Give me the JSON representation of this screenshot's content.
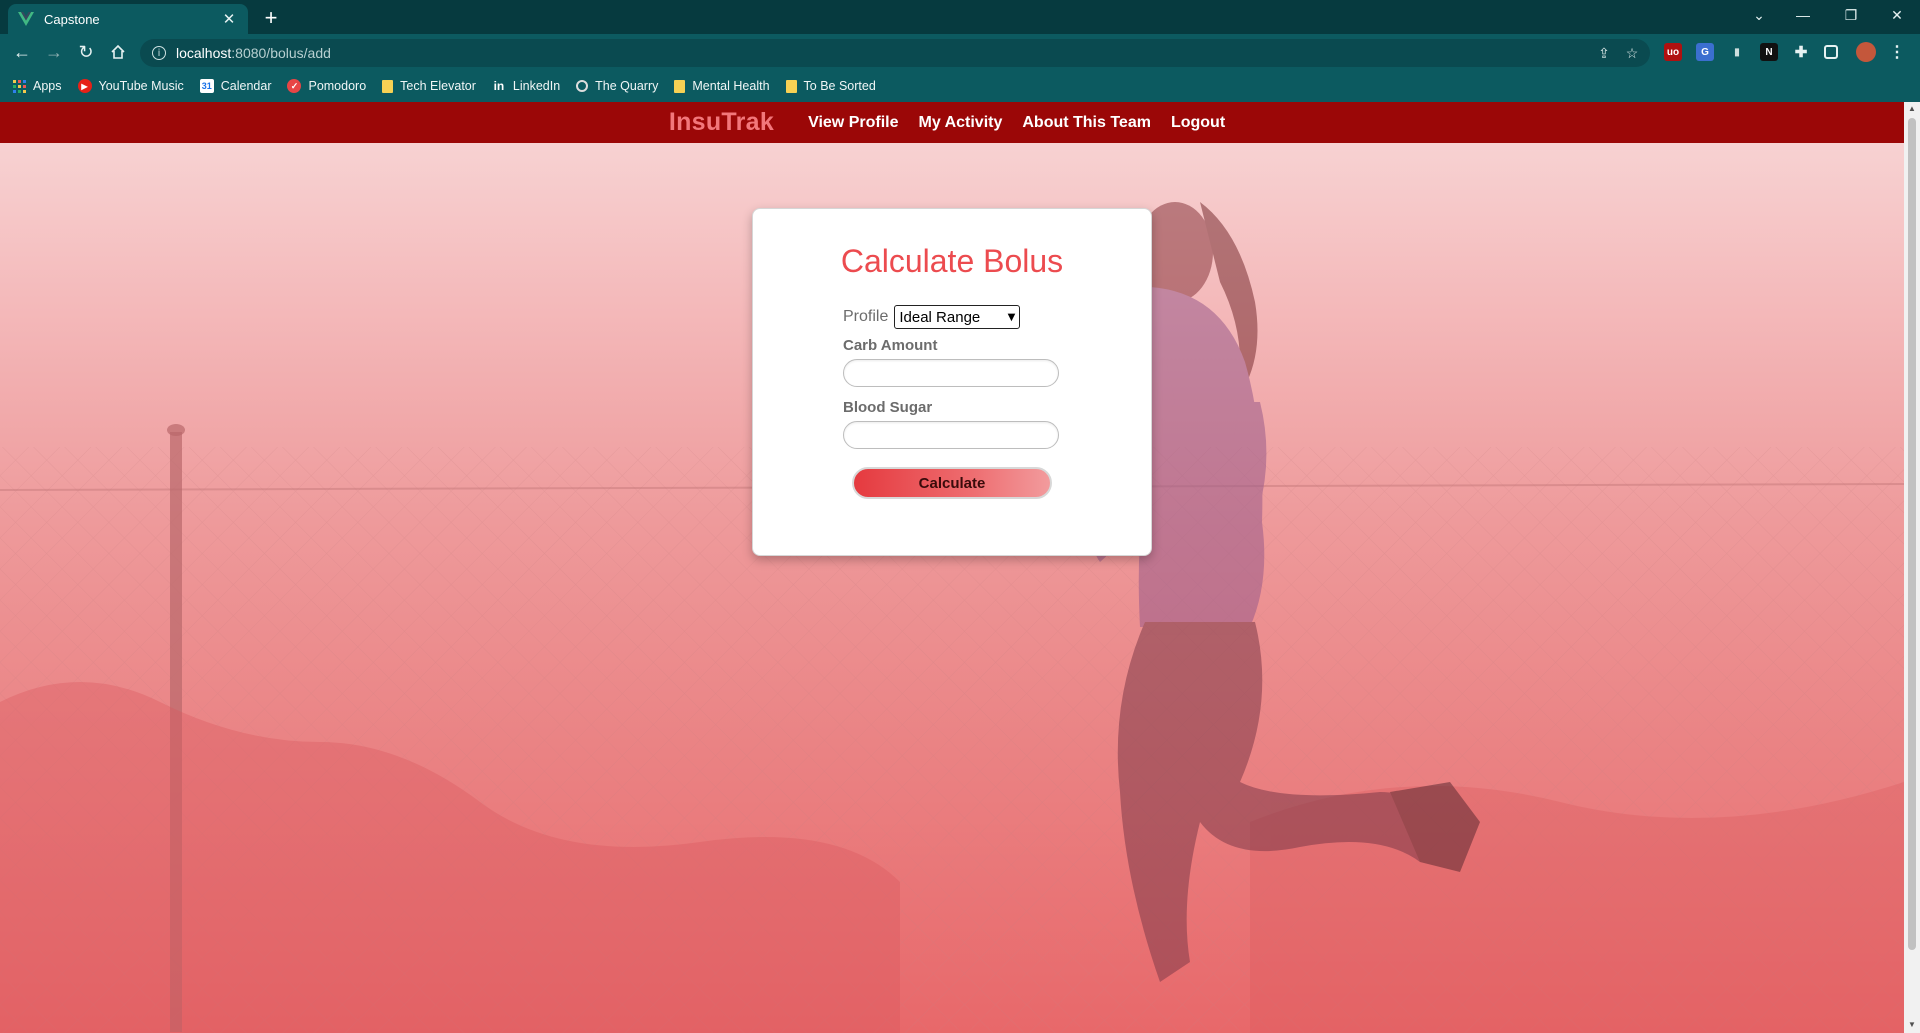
{
  "browser": {
    "tab": {
      "title": "Capstone",
      "close": "✕"
    },
    "new_tab": "+",
    "address": {
      "host": "localhost",
      "path": ":8080/bolus/add"
    },
    "bookmarks": [
      {
        "label": "Apps",
        "icon": "apps-grid-icon"
      },
      {
        "label": "YouTube Music",
        "icon": "youtube-music-icon"
      },
      {
        "label": "Calendar",
        "icon": "calendar-icon"
      },
      {
        "label": "Pomodoro",
        "icon": "pomodoro-icon"
      },
      {
        "label": "Tech Elevator",
        "icon": "folder-icon"
      },
      {
        "label": "LinkedIn",
        "icon": "linkedin-icon"
      },
      {
        "label": "The Quarry",
        "icon": "quarry-icon"
      },
      {
        "label": "Mental Health",
        "icon": "folder-icon"
      },
      {
        "label": "To Be Sorted",
        "icon": "folder-icon"
      }
    ]
  },
  "site": {
    "brand": "InsuTrak",
    "nav": [
      "View Profile",
      "My Activity",
      "About This Team",
      "Logout"
    ]
  },
  "form": {
    "title": "Calculate Bolus",
    "profile_label": "Profile",
    "profile_selected": "Ideal Range",
    "carb_label": "Carb Amount",
    "carb_value": "",
    "blood_sugar_label": "Blood Sugar",
    "blood_sugar_value": "",
    "submit_label": "Calculate"
  },
  "colors": {
    "nav_bg": "#9b0707",
    "brand": "#f2777b",
    "title": "#ec4b4f",
    "chrome": "#0c5a60"
  }
}
